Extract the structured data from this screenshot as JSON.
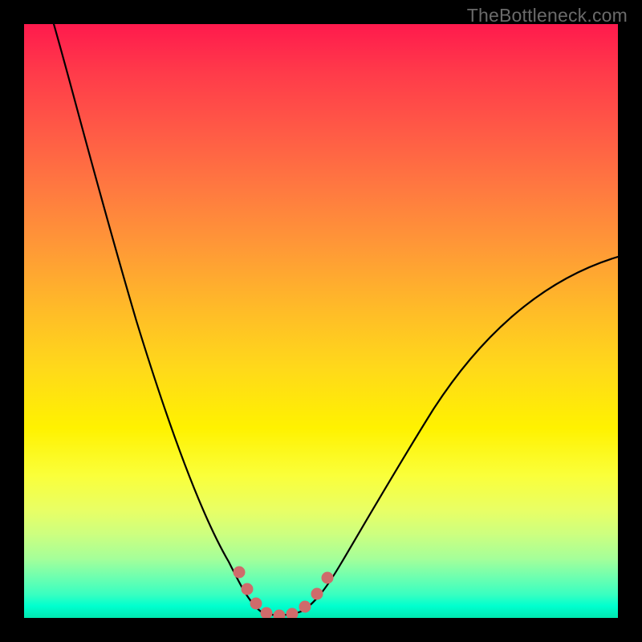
{
  "watermark": "TheBottleneck.com",
  "chart_data": {
    "type": "line",
    "title": "",
    "xlabel": "",
    "ylabel": "",
    "xlim": [
      0,
      100
    ],
    "ylim": [
      0,
      100
    ],
    "grid": false,
    "legend": false,
    "series": [
      {
        "name": "bottleneck-curve",
        "x": [
          5,
          10,
          15,
          20,
          25,
          30,
          33,
          36,
          38,
          40,
          42,
          44,
          46,
          48,
          52,
          56,
          60,
          66,
          72,
          80,
          88,
          96,
          100
        ],
        "y": [
          100,
          85,
          70,
          55,
          40,
          26,
          18,
          11,
          6,
          2,
          0,
          0,
          0,
          1,
          5,
          10,
          16,
          24,
          32,
          42,
          50,
          57,
          60
        ]
      }
    ],
    "markers": {
      "name": "pink-dots",
      "color": "#d46a6a",
      "x": [
        36.5,
        38.5,
        40.5,
        42.5,
        44.5,
        46.5,
        49.0,
        51.0,
        52.5
      ],
      "y": [
        10,
        5,
        2,
        0,
        0,
        0.5,
        2.5,
        5,
        8
      ]
    },
    "background_gradient": {
      "top": "#ff1a4d",
      "mid_upper": "#ff9a36",
      "mid": "#fff200",
      "mid_lower": "#ccff80",
      "bottom": "#00e8b0"
    },
    "frame_color": "#000000"
  }
}
